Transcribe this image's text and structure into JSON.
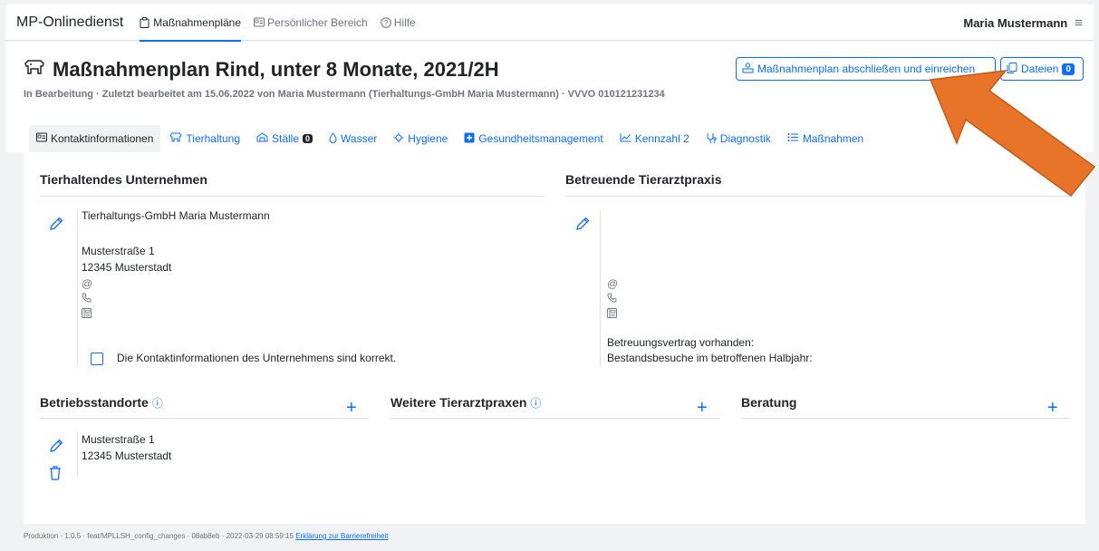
{
  "nav": {
    "brand": "MP-Onlinedienst",
    "items": [
      {
        "label": "Maßnahmenpläne",
        "icon": "clipboard-icon"
      },
      {
        "label": "Persönlicher Bereich",
        "icon": "id-card-icon"
      },
      {
        "label": "Hilfe",
        "icon": "help-icon"
      }
    ],
    "user": "Maria Mustermann",
    "menu_icon": "≡"
  },
  "header": {
    "title": "Maßnahmenplan Rind, unter 8 Monate, 2021/2H",
    "subtitle": "In Bearbeitung · Zuletzt bearbeitet am 15.06.2022 von Maria Mustermann (Tierhaltungs-GmbH Maria Mustermann) · VVVO 010121231234",
    "submit_label": "Maßnahmenplan abschließen und einreichen",
    "files_label": "Dateien",
    "files_count": "0"
  },
  "tabs": [
    {
      "label": "Kontaktinformationen",
      "icon": "id-card-icon",
      "active": true
    },
    {
      "label": "Tierhaltung",
      "icon": "cow-icon"
    },
    {
      "label": "Ställe",
      "icon": "barn-icon",
      "badge": "0"
    },
    {
      "label": "Wasser",
      "icon": "droplet-icon"
    },
    {
      "label": "Hygiene",
      "icon": "virus-icon"
    },
    {
      "label": "Gesundheitsmanagement",
      "icon": "medical-icon"
    },
    {
      "label": "Kennzahl 2",
      "icon": "chart-icon"
    },
    {
      "label": "Diagnostik",
      "icon": "stethoscope-icon"
    },
    {
      "label": "Maßnahmen",
      "icon": "list-icon"
    }
  ],
  "company": {
    "title": "Tierhaltendes Unternehmen",
    "name": "Tierhaltungs-GmbH Maria Mustermann",
    "street": "Musterstraße 1",
    "city": "12345 Musterstadt",
    "checkbox_label": "Die Kontaktinformationen des Unternehmens sind korrekt."
  },
  "vet": {
    "title": "Betreuende Tierarztpraxis",
    "contract": "Betreuungsvertrag vorhanden:",
    "visits": "Bestandsbesuche im betroffenen Halbjahr:"
  },
  "sites": {
    "title": "Betriebsstandorte",
    "street": "Musterstraße 1",
    "city": "12345 Musterstadt"
  },
  "other_vets": {
    "title": "Weitere Tierarztpraxen"
  },
  "advice": {
    "title": "Beratung"
  },
  "footer": {
    "text": "Produktion · 1.0.5 · feat/MPLLSH_config_changes · 08ab8eb · 2022-03-29 08:59:15",
    "link": "Erklärung zur Barrierefreiheit"
  },
  "colors": {
    "accent": "#0d6efd",
    "arrow": "#e8742a"
  }
}
